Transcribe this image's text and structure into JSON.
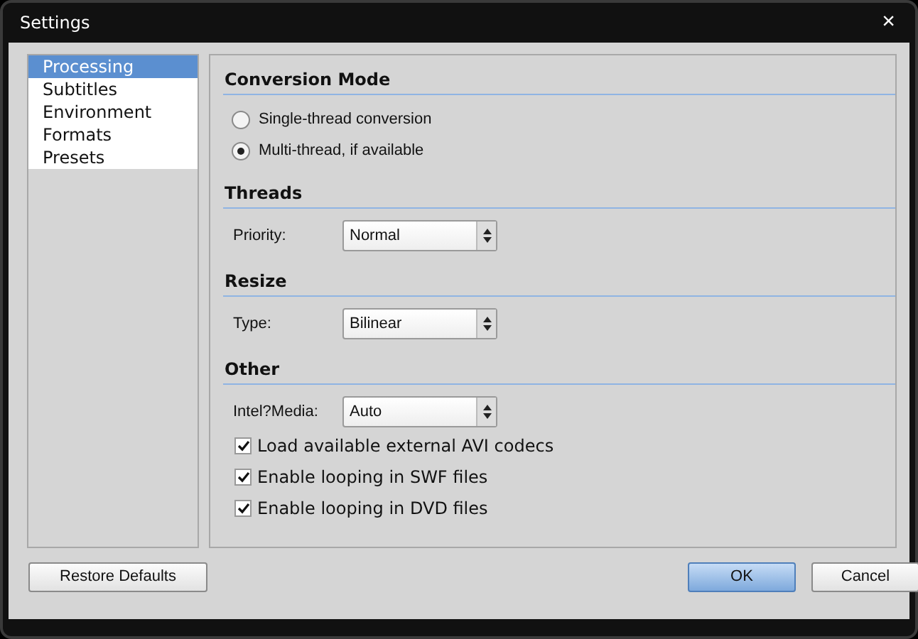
{
  "window": {
    "title": "Settings",
    "close": "×"
  },
  "sidebar": {
    "items": [
      {
        "label": "Processing",
        "selected": true
      },
      {
        "label": "Subtitles",
        "selected": false
      },
      {
        "label": "Environment",
        "selected": false
      },
      {
        "label": "Formats",
        "selected": false
      },
      {
        "label": "Presets",
        "selected": false
      }
    ]
  },
  "sections": [
    {
      "title": "Conversion Mode",
      "rows": [
        {
          "kind": "radio",
          "label": "Single-thread conversion",
          "selected": false
        },
        {
          "kind": "radio",
          "label": "Multi-thread, if available",
          "selected": true
        }
      ]
    },
    {
      "title": "Threads",
      "rows": [
        {
          "kind": "select",
          "label": "Priority:",
          "value": "Normal"
        }
      ]
    },
    {
      "title": "Resize",
      "rows": [
        {
          "kind": "select",
          "label": "Type:",
          "value": "Bilinear"
        }
      ]
    },
    {
      "title": "Other",
      "rows": [
        {
          "kind": "select",
          "label": "Intel?Media:",
          "value": "Auto"
        },
        {
          "kind": "checkbox",
          "label": "Load available external AVI codecs",
          "checked": true
        },
        {
          "kind": "checkbox",
          "label": "Enable looping in SWF files",
          "checked": true
        },
        {
          "kind": "checkbox",
          "label": "Enable looping in DVD files",
          "checked": true
        }
      ]
    }
  ],
  "buttons": [
    {
      "label": "Restore Defaults",
      "kind": "plain"
    },
    {
      "label": "OK",
      "kind": "default"
    },
    {
      "label": "Cancel",
      "kind": "plain"
    }
  ]
}
